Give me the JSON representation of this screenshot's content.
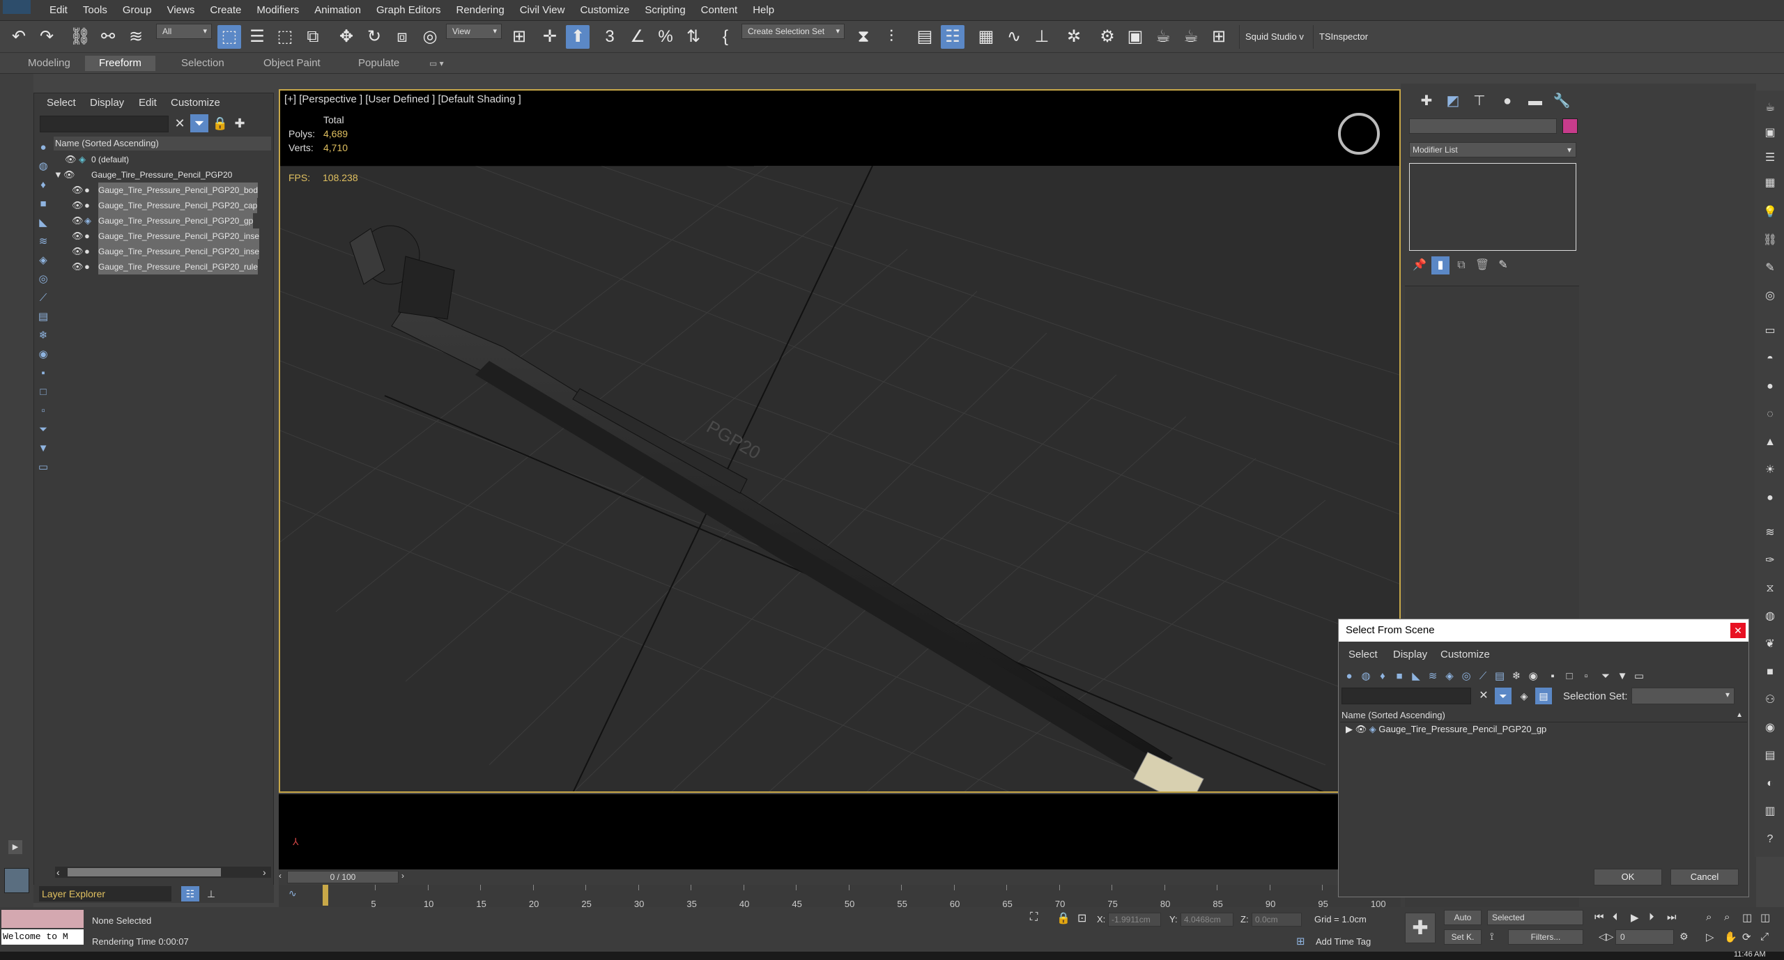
{
  "menubar": {
    "items": [
      "Edit",
      "Tools",
      "Group",
      "Views",
      "Create",
      "Modifiers",
      "Animation",
      "Graph Editors",
      "Rendering",
      "Civil View",
      "Customize",
      "Scripting",
      "Content",
      "Help"
    ]
  },
  "toolbar": {
    "filter_value": "All",
    "view_value": "View",
    "selection_set_value": "Create Selection Set",
    "squid_label": "Squid Studio v",
    "tsinspector_label": "TSInspector"
  },
  "ribbon": {
    "tabs": [
      "Modeling",
      "Freeform",
      "Selection",
      "Object Paint",
      "Populate"
    ],
    "active_tab": "Freeform"
  },
  "explorer": {
    "menu": [
      "Select",
      "Display",
      "Edit",
      "Customize"
    ],
    "header": "Name (Sorted Ascending)",
    "rows": [
      {
        "label": "0 (default)"
      },
      {
        "label": "Gauge_Tire_Pressure_Pencil_PGP20"
      },
      {
        "label": "Gauge_Tire_Pressure_Pencil_PGP20_bod"
      },
      {
        "label": "Gauge_Tire_Pressure_Pencil_PGP20_cap"
      },
      {
        "label": "Gauge_Tire_Pressure_Pencil_PGP20_gp"
      },
      {
        "label": "Gauge_Tire_Pressure_Pencil_PGP20_inse"
      },
      {
        "label": "Gauge_Tire_Pressure_Pencil_PGP20_inse"
      },
      {
        "label": "Gauge_Tire_Pressure_Pencil_PGP20_rule"
      }
    ],
    "layer_explorer_label": "Layer Explorer"
  },
  "viewport": {
    "label": "[+] [Perspective ] [User Defined ] [Default Shading ]",
    "stats": {
      "total_label": "Total",
      "polys_label": "Polys:",
      "polys_value": "4,689",
      "verts_label": "Verts:",
      "verts_value": "4,710",
      "fps_label": "FPS:",
      "fps_value": "108.238"
    },
    "model_text": "PGP20"
  },
  "command_panel": {
    "modifier_list": "Modifier List",
    "swatch_color": "#c83c8c"
  },
  "timeline": {
    "frame_label": "0 / 100",
    "ticks": [
      "5",
      "10",
      "15",
      "20",
      "25",
      "30",
      "35",
      "40",
      "45",
      "50",
      "55",
      "60",
      "65",
      "70",
      "75",
      "80",
      "85",
      "90",
      "95",
      "100"
    ]
  },
  "statusbar": {
    "maxscript_text": "Welcome to M",
    "selection_status": "None Selected",
    "render_time": "Rendering Time 0:00:07",
    "x_label": "X:",
    "x_value": "-1.9911cm",
    "y_label": "Y:",
    "y_value": "4.0468cm",
    "z_label": "Z:",
    "z_value": "0.0cm",
    "grid": "Grid = 1.0cm",
    "add_time_tag": "Add Time Tag",
    "auto_label": "Auto",
    "setk_label": "Set K.",
    "selected_value": "Selected",
    "filters_label": "Filters...",
    "frame_value": "0",
    "clock": "11:46 AM"
  },
  "dialog": {
    "title": "Select From Scene",
    "menu": [
      "Select",
      "Display",
      "Customize"
    ],
    "selection_set_label": "Selection Set:",
    "header": "Name (Sorted Ascending)",
    "item": "Gauge_Tire_Pressure_Pencil_PGP20_gp",
    "ok_label": "OK",
    "cancel_label": "Cancel"
  }
}
